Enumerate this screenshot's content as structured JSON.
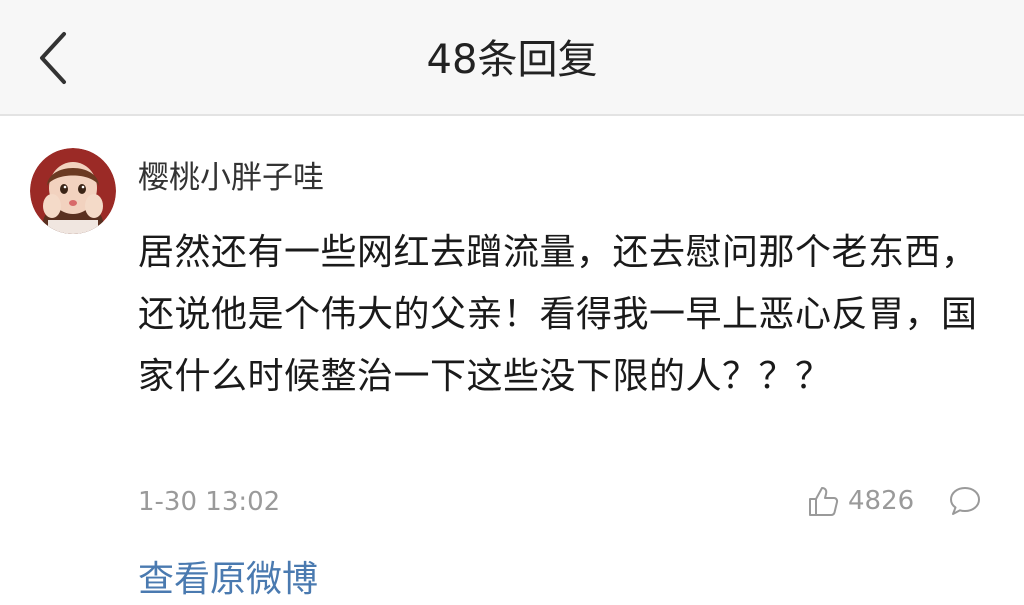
{
  "header": {
    "back_icon": "chevron-left-icon",
    "title": "48条回复"
  },
  "comment": {
    "avatar_icon": "user-avatar",
    "username": "樱桃小胖子哇",
    "text": "居然还有一些网红去蹭流量，还去慰问那个老东西，还说他是个伟大的父亲！看得我一早上恶心反胃，国家什么时候整治一下这些没下限的人？？？",
    "timestamp": "1-30 13:02",
    "like_icon": "thumbs-up-icon",
    "like_count": "4826",
    "reply_icon": "comment-bubble-icon"
  },
  "footer": {
    "view_original_label": "查看原微博"
  },
  "colors": {
    "header_bg": "#f7f7f7",
    "link": "#4a7ab0",
    "muted_text": "#9a9a9a"
  }
}
